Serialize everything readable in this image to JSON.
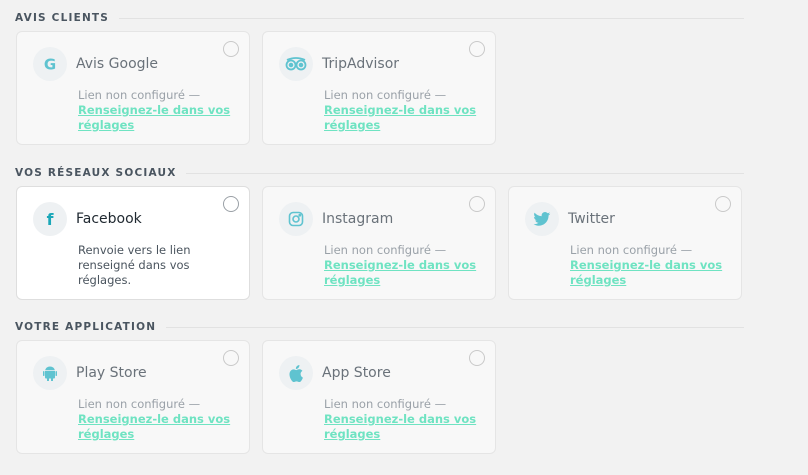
{
  "sections": [
    {
      "title": "AVIS CLIENTS",
      "cards": [
        {
          "name": "Avis Google",
          "icon": "google-icon",
          "status": "Lien non configuré —",
          "link": "Renseignez-le dans vos réglages"
        },
        {
          "name": "TripAdvisor",
          "icon": "tripadvisor-icon",
          "status": "Lien non configuré —",
          "link": "Renseignez-le dans vos réglages"
        }
      ]
    },
    {
      "title": "VOS RÉSEAUX SOCIAUX",
      "cards": [
        {
          "name": "Facebook",
          "icon": "facebook-icon",
          "description": "Renvoie vers le lien renseigné dans vos réglages."
        },
        {
          "name": "Instagram",
          "icon": "instagram-icon",
          "status": "Lien non configuré —",
          "link": "Renseignez-le dans vos réglages"
        },
        {
          "name": "Twitter",
          "icon": "twitter-icon",
          "status": "Lien non configuré —",
          "link": "Renseignez-le dans vos réglages"
        }
      ]
    },
    {
      "title": "VOTRE APPLICATION",
      "cards": [
        {
          "name": "Play Store",
          "icon": "android-icon",
          "status": "Lien non configuré —",
          "link": "Renseignez-le dans vos réglages"
        },
        {
          "name": "App Store",
          "icon": "apple-icon",
          "status": "Lien non configuré —",
          "link": "Renseignez-le dans vos réglages"
        }
      ]
    }
  ],
  "colors": {
    "accent_icon": "#5fc3d0",
    "link": "#6fe3c2",
    "background": "#f2f2f2"
  }
}
